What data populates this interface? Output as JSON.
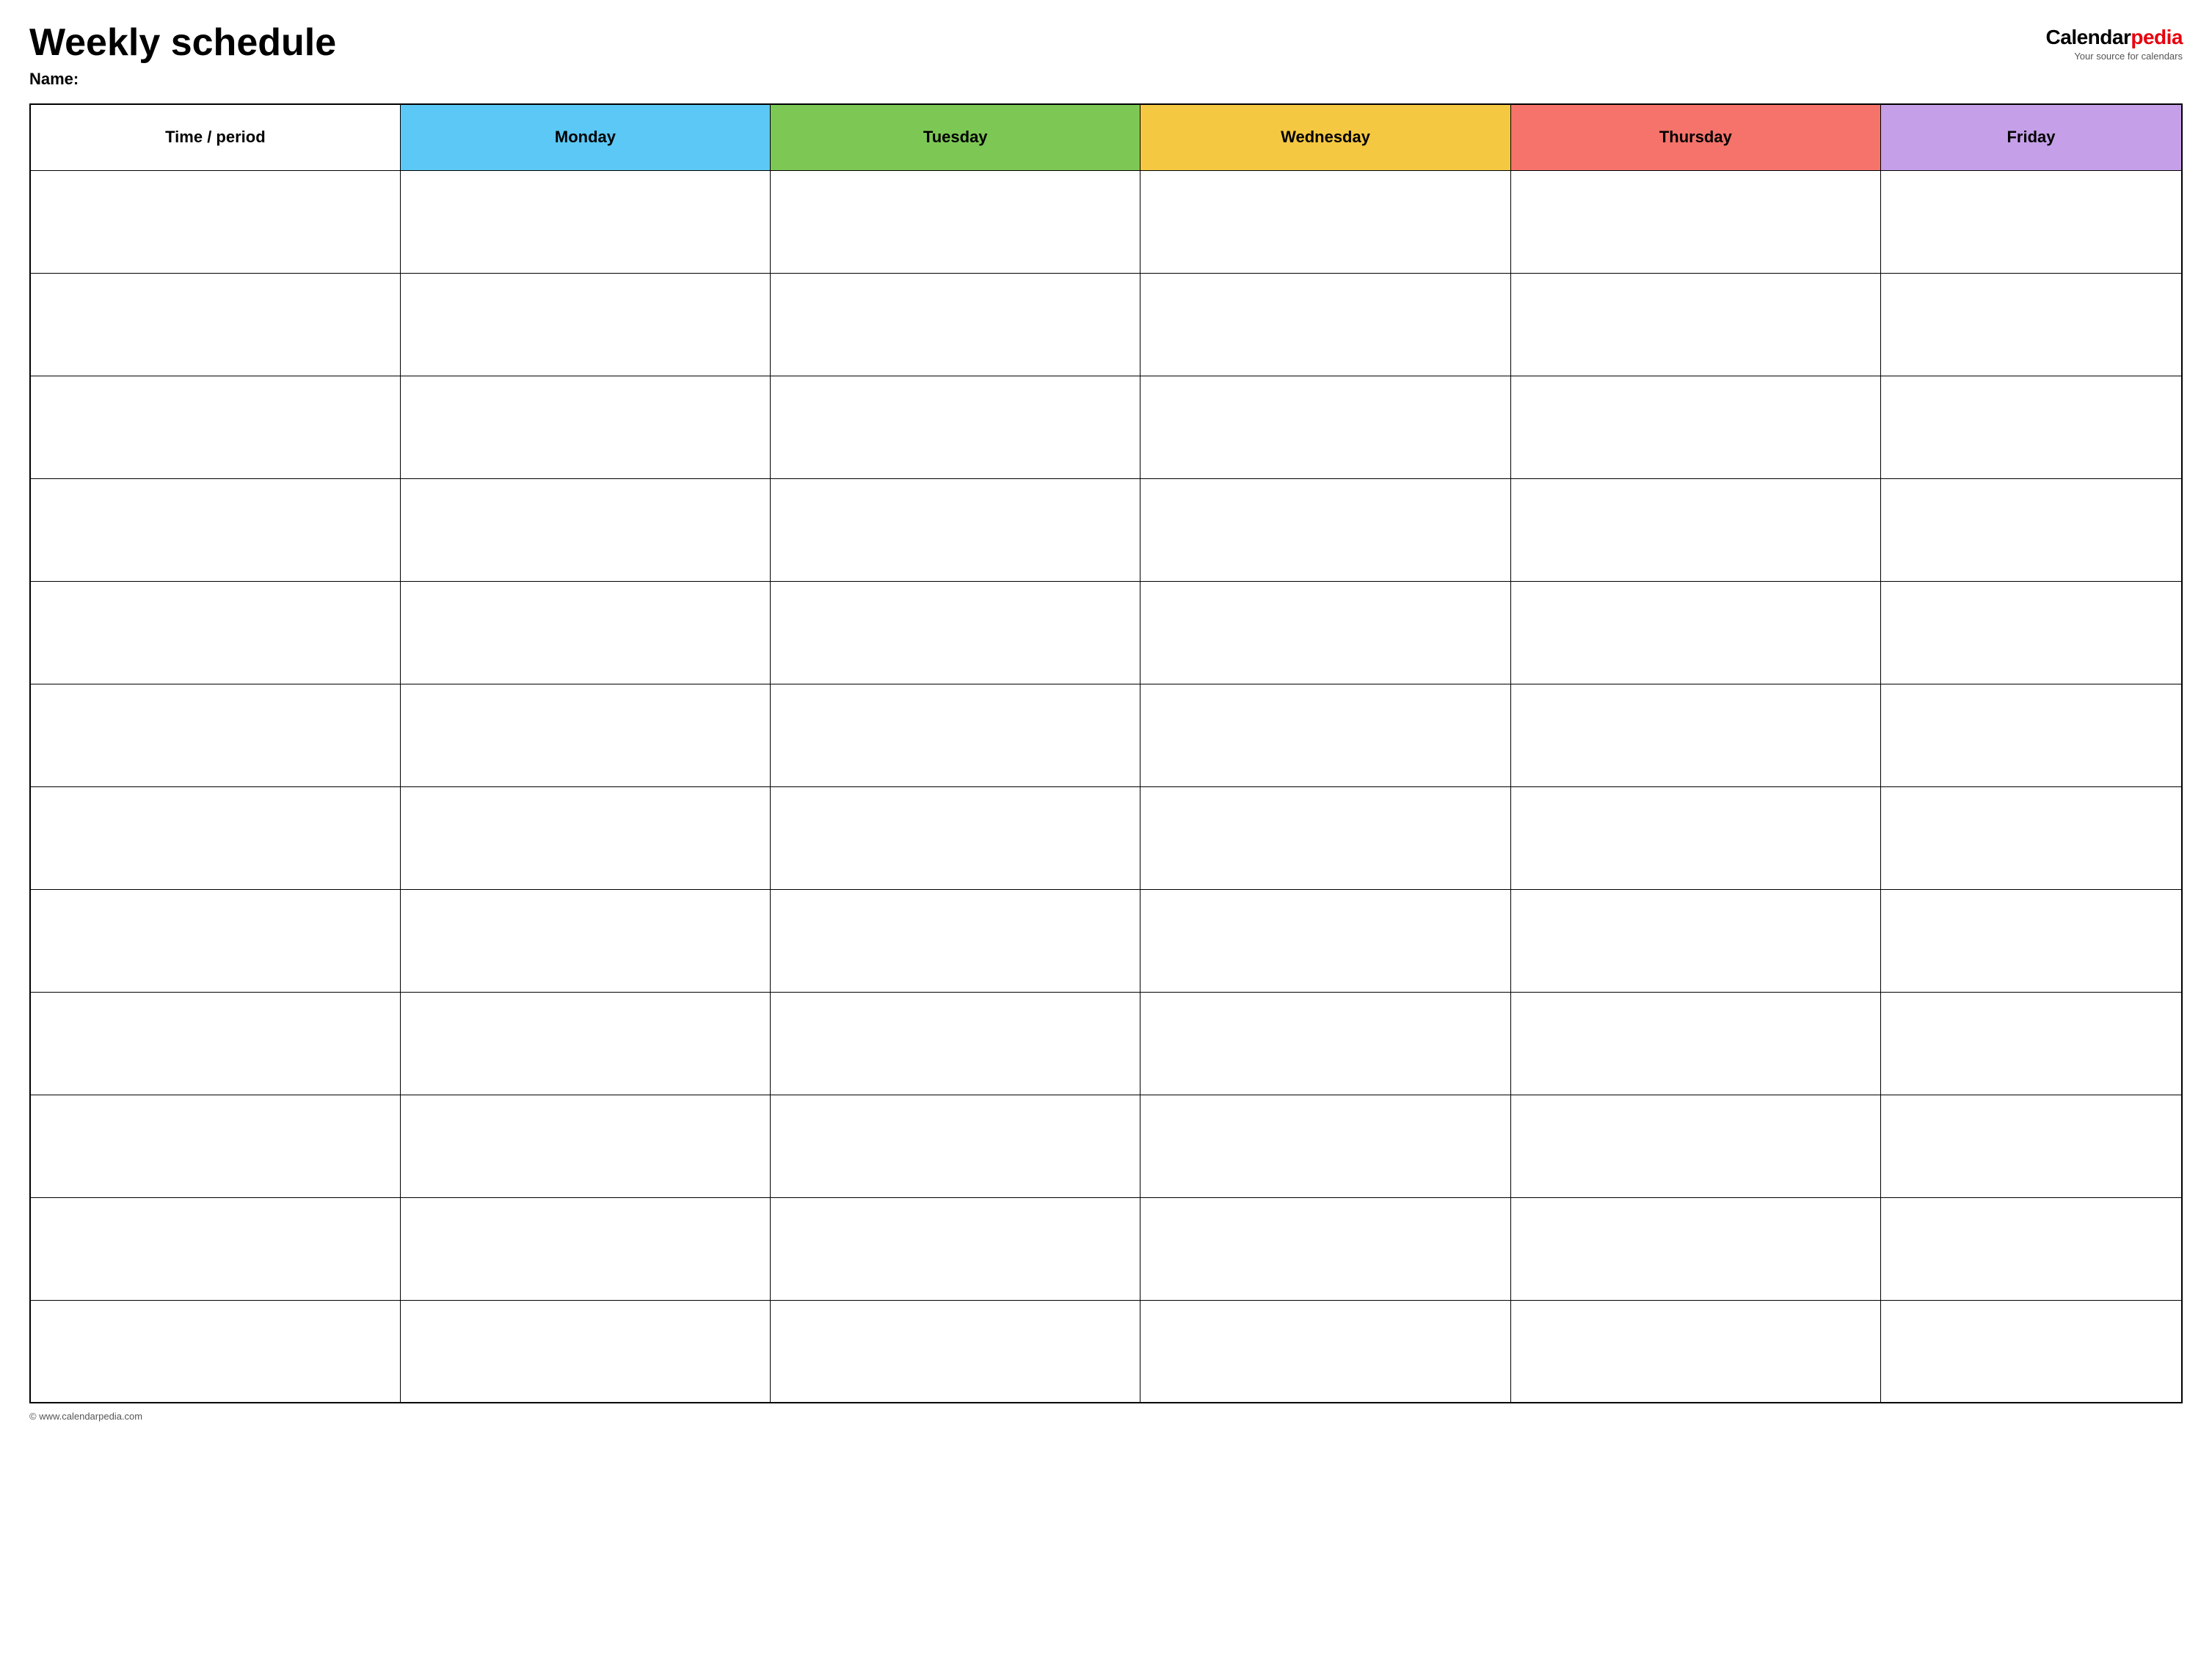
{
  "header": {
    "title": "Weekly schedule",
    "name_label": "Name:",
    "logo": {
      "calendar_text": "Calendar",
      "pedia_text": "pedia",
      "tagline": "Your source for calendars"
    }
  },
  "table": {
    "columns": [
      {
        "id": "time",
        "label": "Time / period",
        "color": "#ffffff"
      },
      {
        "id": "monday",
        "label": "Monday",
        "color": "#5bc8f5"
      },
      {
        "id": "tuesday",
        "label": "Tuesday",
        "color": "#7dc855"
      },
      {
        "id": "wednesday",
        "label": "Wednesday",
        "color": "#f5c842"
      },
      {
        "id": "thursday",
        "label": "Thursday",
        "color": "#f5736a"
      },
      {
        "id": "friday",
        "label": "Friday",
        "color": "#c5a0e8"
      }
    ],
    "row_count": 12
  },
  "footer": {
    "url": "© www.calendarpedia.com"
  }
}
